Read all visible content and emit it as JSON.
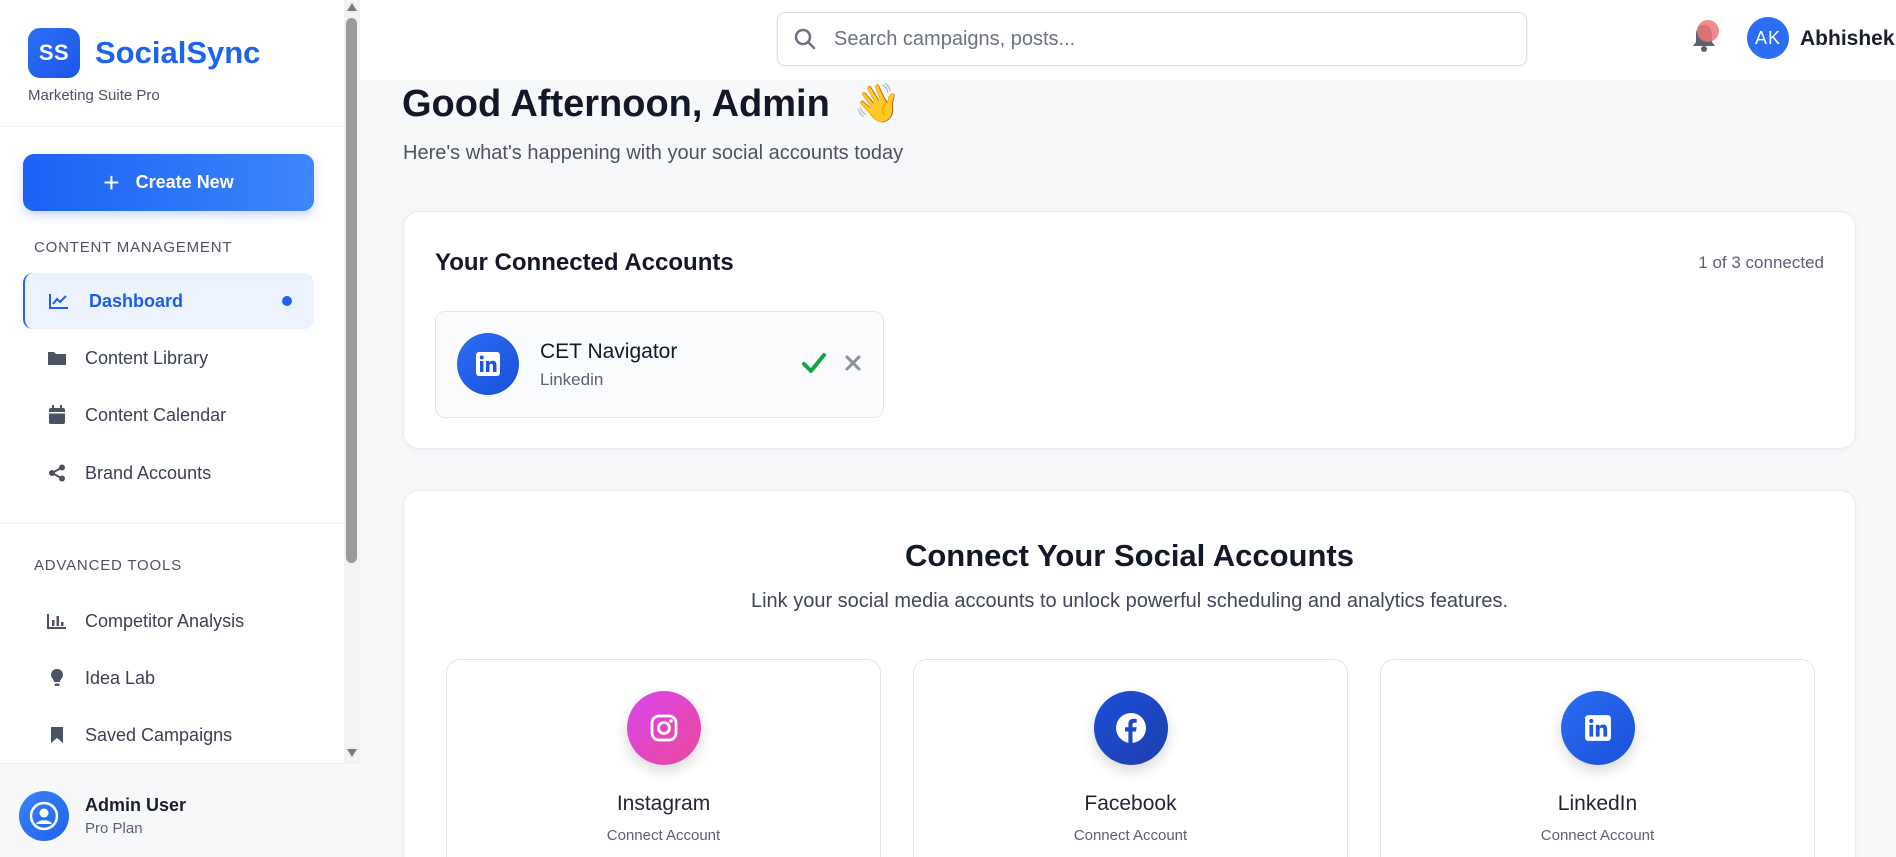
{
  "brand": {
    "logo": "SS",
    "name": "SocialSync",
    "subtitle": "Marketing Suite Pro"
  },
  "sidebar": {
    "create_label": "Create New",
    "sections": [
      {
        "label": "CONTENT MANAGEMENT"
      },
      {
        "label": "ADVANCED TOOLS"
      }
    ],
    "items": [
      {
        "label": "Dashboard",
        "icon": "chart-line-icon",
        "active": true
      },
      {
        "label": "Content Library",
        "icon": "folder-icon"
      },
      {
        "label": "Content Calendar",
        "icon": "calendar-icon"
      },
      {
        "label": "Brand Accounts",
        "icon": "share-icon"
      },
      {
        "label": "Competitor Analysis",
        "icon": "bar-chart-icon"
      },
      {
        "label": "Idea Lab",
        "icon": "lightbulb-icon"
      },
      {
        "label": "Saved Campaigns",
        "icon": "bookmark-icon"
      }
    ],
    "user": {
      "name": "Admin User",
      "plan": "Pro Plan"
    }
  },
  "header": {
    "search_placeholder": "Search campaigns, posts...",
    "avatar_initials": "AK",
    "user_name": "Abhishek"
  },
  "main": {
    "greeting": "Good Afternoon, Admin",
    "greeting_emoji": "👋",
    "subtitle": "Here's what's happening with your social accounts today",
    "connected": {
      "title": "Your Connected Accounts",
      "count_text": "1 of 3 connected",
      "accounts": [
        {
          "name": "CET Navigator",
          "platform": "Linkedin"
        }
      ]
    },
    "connect": {
      "title": "Connect Your Social Accounts",
      "subtitle": "Link your social media accounts to unlock powerful scheduling and analytics features.",
      "platforms": [
        {
          "name": "Instagram",
          "action": "Connect Account",
          "color": "#e1306c"
        },
        {
          "name": "Facebook",
          "action": "Connect Account",
          "color": "#1d4ed8"
        },
        {
          "name": "LinkedIn",
          "action": "Connect Account",
          "color": "#2563eb"
        }
      ]
    }
  },
  "colors": {
    "accent": "#1d63f0",
    "success": "#16a34a"
  }
}
